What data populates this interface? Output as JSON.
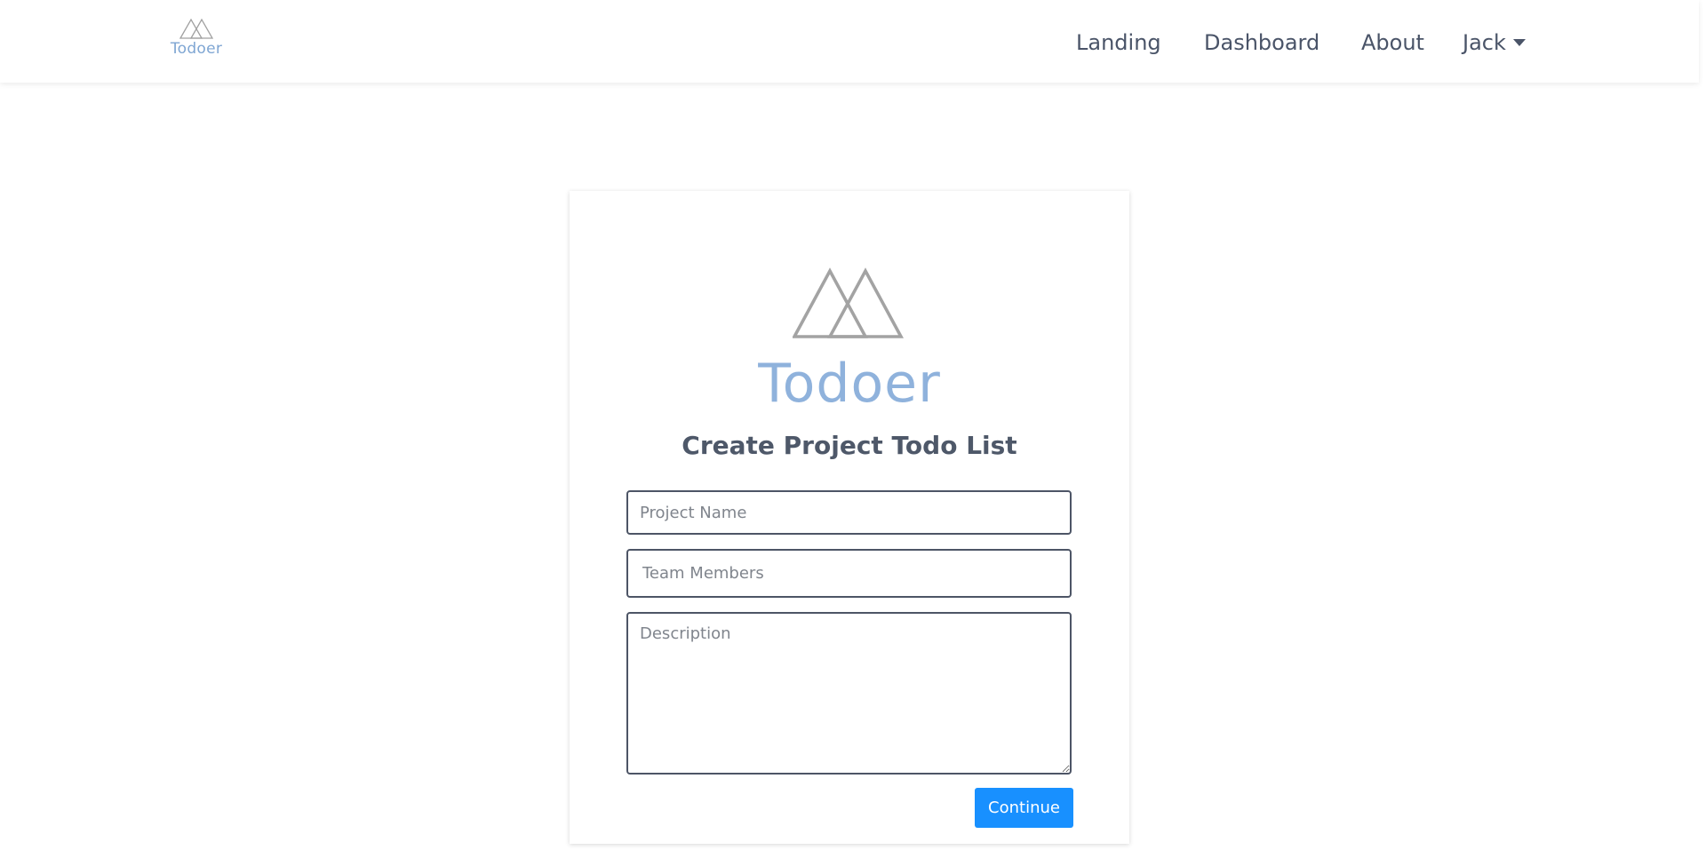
{
  "header": {
    "brand_name": "Todoer",
    "logo_icon": "mountain-peaks-icon",
    "nav": {
      "landing": "Landing",
      "dashboard": "Dashboard",
      "about": "About",
      "user": "Jack"
    },
    "user_menu_icon": "caret-down-icon"
  },
  "card": {
    "logo_icon": "mountain-peaks-icon",
    "brand_name": "Todoer",
    "title": "Create Project Todo List",
    "fields": {
      "project_name": {
        "value": "",
        "placeholder": "Project Name"
      },
      "team_members": {
        "value": "",
        "placeholder": "Team Members"
      },
      "description": {
        "value": "",
        "placeholder": "Description"
      }
    },
    "continue_label": "Continue"
  },
  "colors": {
    "brand_blue": "#8fb2dc",
    "nav_text": "#4a5468",
    "primary_button": "#1890ff",
    "logo_stroke": "#a0a0a0"
  }
}
